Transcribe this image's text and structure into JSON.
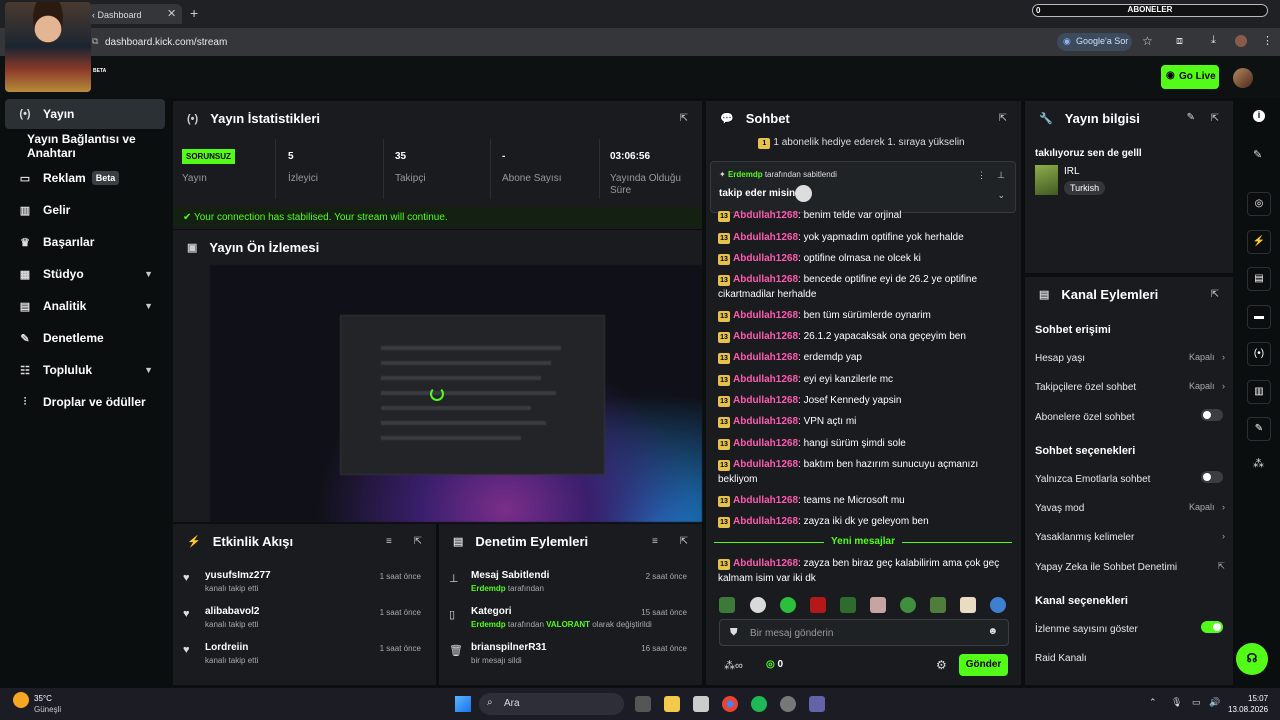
{
  "browser": {
    "tab_title": "‹ Dashboard",
    "url": "dashboard.kick.com/stream",
    "google_ask": "Google'a Sor",
    "overlay_counter": "0",
    "overlay_label": "ABONELER",
    "beta_tag": "BETA"
  },
  "header": {
    "go_live": "Go Live"
  },
  "sidebar": {
    "items": [
      {
        "label": "Yayın",
        "icon": "stream-icon"
      },
      {
        "label": "Yayın Bağlantısı ve Anahtarı",
        "icon": ""
      },
      {
        "label": "Reklam",
        "icon": "ad-icon",
        "badge": "Beta"
      },
      {
        "label": "Gelir",
        "icon": "revenue-icon"
      },
      {
        "label": "Başarılar",
        "icon": "trophy-icon"
      },
      {
        "label": "Stüdyo",
        "icon": "studio-icon"
      },
      {
        "label": "Analitik",
        "icon": "chart-icon"
      },
      {
        "label": "Denetleme",
        "icon": "wrench-icon"
      },
      {
        "label": "Topluluk",
        "icon": "community-icon"
      },
      {
        "label": "Droplar ve ödüller",
        "icon": "drops-icon"
      }
    ]
  },
  "stats": {
    "title": "Yayın İstatistikleri",
    "items": [
      {
        "value": "SORUNSUZ",
        "label": "Yayın"
      },
      {
        "value": "5",
        "label": "İzleyici"
      },
      {
        "value": "35",
        "label": "Takipçi"
      },
      {
        "value": "-",
        "label": "Abone Sayısı"
      },
      {
        "value": "03:06:56",
        "label": "Yayında Olduğu Süre"
      }
    ],
    "notice": "Your connection has stabilised. Your stream will continue."
  },
  "preview": {
    "title": "Yayın Ön İzlemesi"
  },
  "activity": {
    "title": "Etkinlik Akışı",
    "items": [
      {
        "name": "yusufsImz277",
        "sub": "kanalı takip etti",
        "time": "1 saat önce"
      },
      {
        "name": "alibabavol2",
        "sub": "kanalı takip etti",
        "time": "1 saat önce"
      },
      {
        "name": "Lordreiin",
        "sub": "kanalı takip etti",
        "time": "1 saat önce"
      }
    ]
  },
  "moderation": {
    "title": "Denetim Eylemleri",
    "items": [
      {
        "name": "Mesaj Sabitlendi",
        "sub_user": "Erdemdp",
        "sub_text": " tarafından",
        "sub_extra": "",
        "sub_tail": "",
        "time": "2 saat önce"
      },
      {
        "name": "Kategori",
        "sub_user": "Erdemdp",
        "sub_text": " tarafından ",
        "sub_extra": "VALORANT",
        "sub_tail": " olarak değiştirildi",
        "time": "15 saat önce"
      },
      {
        "name": "brianspilnerR31",
        "sub_user": "",
        "sub_text": "bir mesajı sildi",
        "sub_extra": "",
        "sub_tail": "",
        "time": "16 saat önce"
      }
    ]
  },
  "chat": {
    "title": "Sohbet",
    "gift_banner": "1 abonelik hediye ederek 1. sıraya yükselin",
    "pinned_user": "Erdemdp",
    "pinned_by": " tarafından sabitlendi",
    "pinned_text": "takip eder misin",
    "badge": "13",
    "messages": [
      {
        "user": "Abdullah1268",
        "text": ": benim telde var orjinal"
      },
      {
        "user": "Abdullah1268",
        "text": ": yok yapmadım optifine yok herhalde"
      },
      {
        "user": "Abdullah1268",
        "text": ": optifine olmasa ne olcek ki"
      },
      {
        "user": "Abdullah1268",
        "text": ": bencede optifine eyi de 26.2 ye optifine cikartmadilar herhalde"
      },
      {
        "user": "Abdullah1268",
        "text": ": ben tüm sürümlerde oynarim"
      },
      {
        "user": "Abdullah1268",
        "text": ": 26.1.2 yapacaksak ona geçeyim ben"
      },
      {
        "user": "Abdullah1268",
        "text": ": erdemdp yap"
      },
      {
        "user": "Abdullah1268",
        "text": ": eyi eyi kanzilerle mc"
      },
      {
        "user": "Abdullah1268",
        "text": ": Josef Kennedy yapsin"
      },
      {
        "user": "Abdullah1268",
        "text": ": VPN açtı mi"
      },
      {
        "user": "Abdullah1268",
        "text": ": hangi sürüm şimdi sole"
      },
      {
        "user": "Abdullah1268",
        "text": ": baktım ben hazırım sunucuyu açmanızı bekliyom"
      },
      {
        "user": "Abdullah1268",
        "text": ": teams ne Microsoft mu"
      },
      {
        "user": "Abdullah1268",
        "text": ": zayza iki dk ye geleyom ben"
      }
    ],
    "new_messages": "Yeni mesajlar",
    "last_message": {
      "user": "Abdullah1268",
      "text": ": zayza ben biraz geç kalabilirim ama çok geç kalmam isim var iki dk"
    },
    "input_placeholder": "Bir mesaj gönderin",
    "infinity": "∞",
    "points": "0",
    "send": "Gönder"
  },
  "stream_info": {
    "title": "Yayın bilgisi",
    "stream_title": "takılıyoruz sen de gelll",
    "category": "IRL",
    "tag": "Turkish"
  },
  "channel_actions": {
    "title": "Kanal Eylemleri",
    "chat_access": "Sohbet erişimi",
    "account_age": "Hesap yaşı",
    "account_age_value": "Kapalı",
    "followers_only": "Takipçilere özel sohbet",
    "followers_only_value": "Kapalı",
    "subs_only": "Abonelere özel sohbet",
    "chat_options": "Sohbet seçenekleri",
    "emote_only": "Yalnızca Emotlarla sohbet",
    "slow_mode": "Yavaş mod",
    "slow_mode_value": "Kapalı",
    "banned_words": "Yasaklanmış kelimeler",
    "ai_moderation": "Yapay Zeka ile Sohbet Denetimi",
    "channel_options": "Kanal seçenekleri",
    "show_viewers": "İzlenme sayısını göster",
    "raid": "Raid Kanalı"
  },
  "taskbar": {
    "weather_temp": "35°C",
    "weather_desc": "Güneşli",
    "search": "Ara",
    "time": "15:07",
    "date": "13.08.2026"
  },
  "colors": {
    "accent": "#53fc18",
    "username": "#ff5ab0",
    "panel": "#191b1f",
    "badge": "#e5c24a"
  }
}
